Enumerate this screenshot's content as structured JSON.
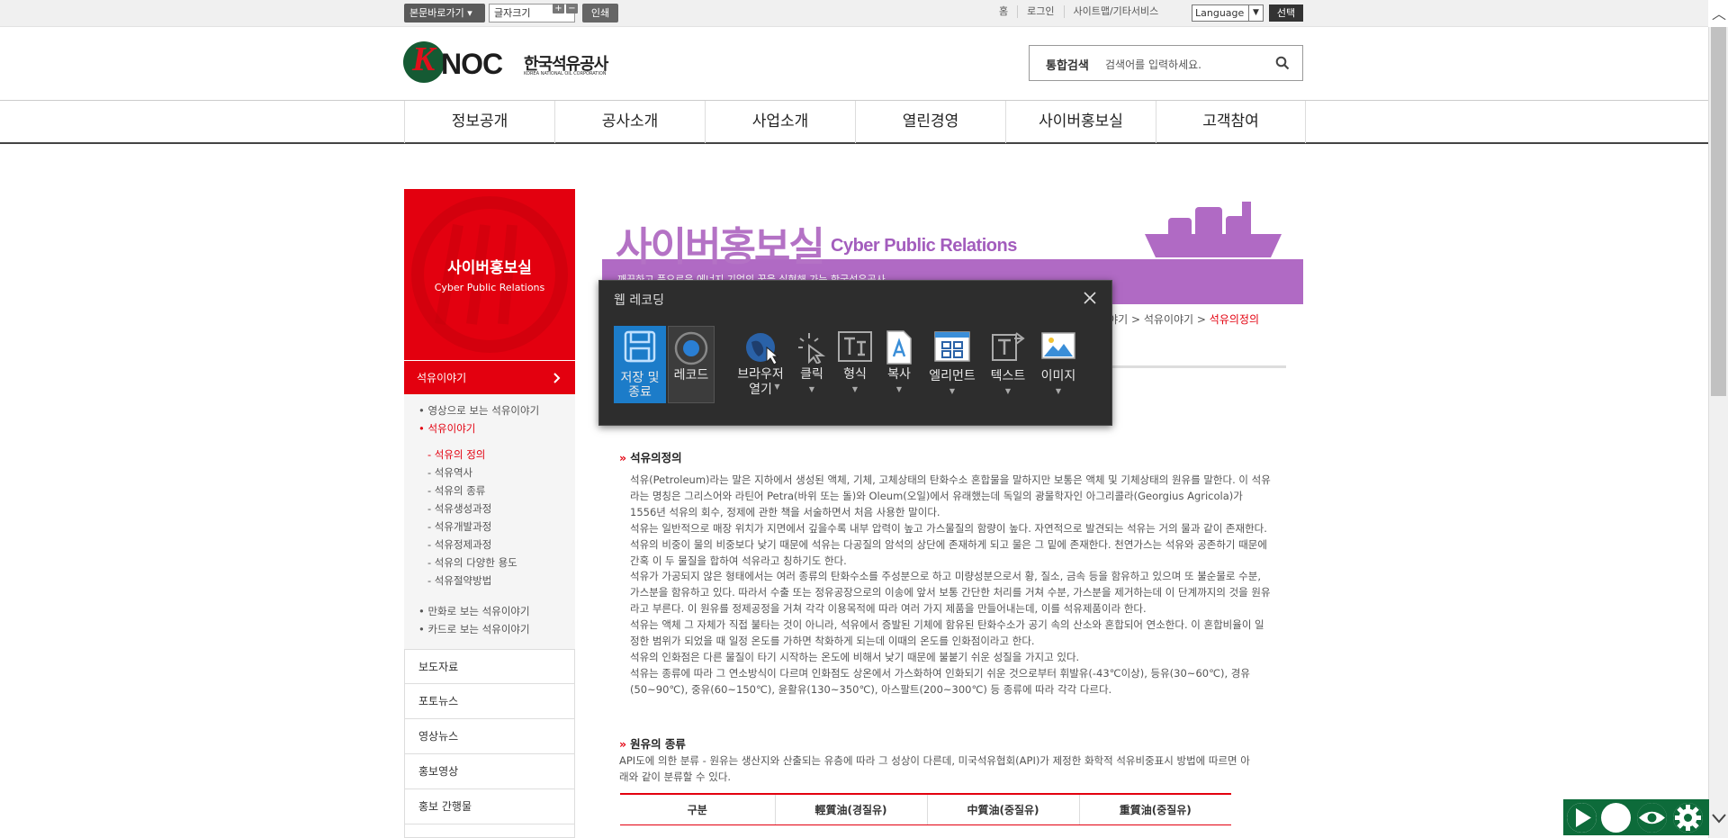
{
  "topbar": {
    "skip_label": "본문바로가기",
    "fontsize_label": "글자크기",
    "fontsize_plus": "+",
    "fontsize_minus": "−",
    "print_label": "인쇄",
    "links": [
      "홈",
      "로그인",
      "사이트맵/기타서비스"
    ],
    "language_label": "Language",
    "choose_label": "선택"
  },
  "header": {
    "logo_mark": "K",
    "logo_noc": "NOC",
    "logo_kr": "한국석유공사",
    "logo_en": "KOREA NATIONAL OIL CORPORATION",
    "search_label": "통합검색",
    "search_placeholder": "검색어를 입력하세요."
  },
  "gnb": [
    "정보공개",
    "공사소개",
    "사업소개",
    "열린경영",
    "사이버홍보실",
    "고객참여"
  ],
  "sidebar": {
    "title": "사이버홍보실",
    "title_en": "Cyber Public Relations",
    "active": "석유이야기",
    "sub_items": [
      "영상으로 보는 석유이야기",
      "석유이야기"
    ],
    "sub_sub_items": [
      "- 석유의 정의",
      "- 석유역사",
      "- 석유의 종류",
      "- 석유생성과정",
      "- 석유개발과정",
      "- 석유정제과정",
      "- 석유의 다양한 용도",
      "- 석유절약방법"
    ],
    "sub_items_after": [
      "만화로 보는 석유이야기",
      "카드로 보는 석유이야기"
    ],
    "items": [
      "보도자료",
      "포토뉴스",
      "영상뉴스",
      "홍보영상",
      "홍보 간행물"
    ]
  },
  "banner": {
    "title": "사이버홍보실",
    "title_en": "Cyber Public Relations",
    "subtitle": "깨끗하고 풍요로운 에너지 기업의 꿈을 실현해 가는 한국석유공사"
  },
  "breadcrumb": {
    "items": [
      "석유이야기",
      "석유이야기"
    ],
    "current": "석유의정의"
  },
  "content": {
    "section1_title": "석유의정의",
    "paragraphs": [
      "석유(Petroleum)라는 말은 지하에서 생성된 액체, 기체, 고체상태의 탄화수소 혼합물을 말하지만 보통은 액체 및 기체상태의 원유를 말한다. 이 석유라는 명칭은 그리스어와 라틴어 Petra(바위 또는 돌)와 Oleum(오일)에서 유래했는데 독일의 광물학자인 아그리콜라(Georgius Agricola)가 1556년 석유의 회수, 정제에 관한 책을 서술하면서 처음 사용한 말이다.",
      "석유는 일반적으로 매장 위치가 지면에서 깊을수록 내부 압력이 높고 가스물질의 함량이 높다. 자연적으로 발견되는 석유는 거의 물과 같이 존재한다. 석유의 비중이 물의 비중보다 낮기 때문에 석유는 다공질의 암석의 상단에 존재하게 되고 물은 그 밑에 존재한다. 천연가스는 석유와 공존하기 때문에 간혹 이 두 물질을 합하여 석유라고 칭하기도 한다.",
      "석유가 가공되지 않은 형태에서는 여러 종류의 탄화수소를 주성분으로 하고 미량성분으로서 황, 질소, 금속 등을 함유하고 있으며 또 불순물로 수분, 가스분을 함유하고 있다. 따라서 수출 또는 정유공장으로의 이송에 앞서 보통 간단한 처리를 거쳐 수분, 가스분을 제거하는데 이 단계까지의 것을 원유라고 부른다. 이 원유를 정제공정을 거쳐 각각 이용목적에 따라 여러 가지 제품을 만들어내는데, 이를 석유제품이라 한다.",
      "석유는 액체 그 자체가 직접 불타는 것이 아니라, 석유에서 증발된 기체에 함유된 탄화수소가 공기 속의 산소와 혼합되어 연소한다. 이 혼합비율이 일정한 범위가 되었을 때 일정 온도를 가하면 착화하게 되는데 이때의 온도를 인화점이라고 한다.",
      "석유의 인화점은 다른 물질이 타기 시작하는 온도에 비해서 낮기 때문에 불붙기 쉬운 성질을 가지고 있다.",
      "석유는 종류에 따라 그 연소방식이 다르며 인화점도 상온에서 가스화하여 인화되기 쉬운 것으로부터 휘발유(-43℃이상), 등유(30~60℃), 경유(50~90℃), 중유(60~150℃), 윤활유(130~350℃), 아스팔트(200~300℃) 등 종류에 따라 각각 다르다."
    ],
    "section2_title": "원유의 종류",
    "section2_text": "API도에 의한 분류 - 원유는 생산지와 산출되는 유층에 따라 그 성상이 다른데, 미국석유협회(API)가 제정한 화학적 석유비중표시 방법에 따르면 아래와 같이 분류할 수 있다.",
    "table_headers": [
      "구분",
      "輕質油(경질유)",
      "中質油(중질유)",
      "重質油(중질유)"
    ]
  },
  "recorder": {
    "title": "웹 레코딩",
    "tools": [
      {
        "name": "save",
        "label": "저장 및 종료"
      },
      {
        "name": "record",
        "label": "레코드"
      },
      {
        "name": "browser",
        "label": "브라우저 열기"
      },
      {
        "name": "click",
        "label": "클릭"
      },
      {
        "name": "format",
        "label": "형식"
      },
      {
        "name": "copy",
        "label": "복사"
      },
      {
        "name": "element",
        "label": "엘리먼트"
      },
      {
        "name": "text",
        "label": "텍스트"
      },
      {
        "name": "image",
        "label": "이미지"
      }
    ]
  },
  "colors": {
    "brand_red": "#e3000f",
    "banner_purple": "#b06ac4",
    "dialog_bg": "#2d2d2d",
    "selected_blue": "#1c7cc9",
    "player_green": "#0d6b3a"
  }
}
